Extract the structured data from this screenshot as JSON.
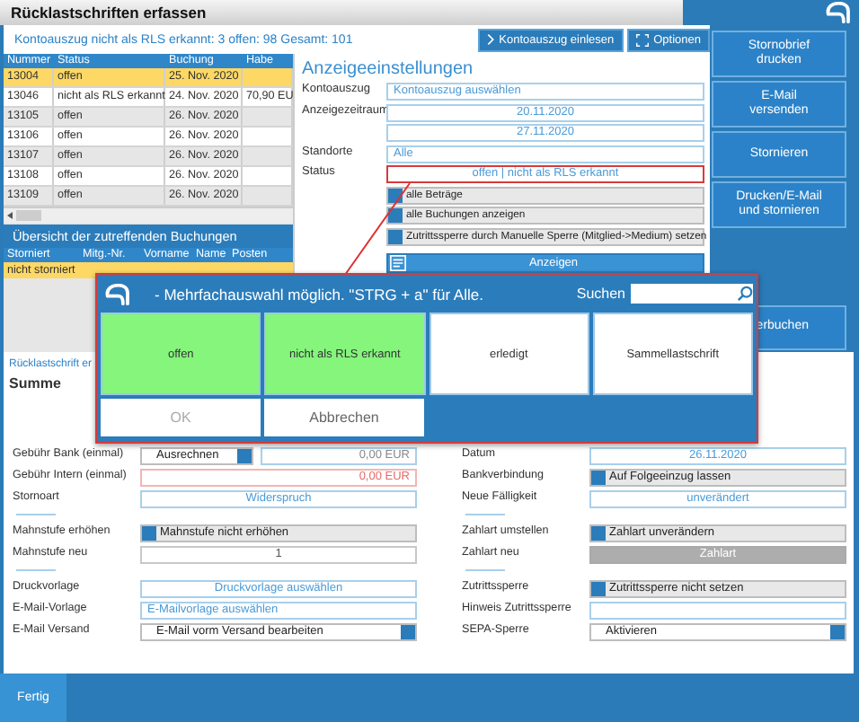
{
  "window": {
    "title": "Rücklastschriften erfassen"
  },
  "summary": "Kontoauszug  nicht als RLS erkannt: 3 offen: 98 Gesamt: 101",
  "toolbar": [
    "Kontoauszug einlesen",
    "Optionen"
  ],
  "bookings_table": {
    "columns": [
      "Nummer",
      "Status",
      "Buchung",
      "Habe"
    ],
    "rows": [
      {
        "cells": [
          "13004",
          "offen",
          "25. Nov. 2020"
        ],
        "selected": true
      },
      {
        "cells": [
          "13046",
          "nicht als RLS erkannt",
          "24. Nov. 2020",
          "70,90 EU"
        ],
        "selected": false
      },
      {
        "cells": [
          "13105",
          "offen",
          "26. Nov. 2020"
        ],
        "selected": false
      },
      {
        "cells": [
          "13106",
          "offen",
          "26. Nov. 2020"
        ],
        "selected": false
      },
      {
        "cells": [
          "13107",
          "offen",
          "26. Nov. 2020"
        ],
        "selected": false
      },
      {
        "cells": [
          "13108",
          "offen",
          "26. Nov. 2020"
        ],
        "selected": false
      },
      {
        "cells": [
          "13109",
          "offen",
          "26. Nov. 2020"
        ],
        "selected": false
      }
    ]
  },
  "overview": {
    "title": "Übersicht der zutreffenden Buchungen",
    "columns": [
      "Storniert",
      "Mitg.-Nr.",
      "Vorname",
      "Name",
      "Posten"
    ],
    "rows": [
      {
        "cells": [
          "nicht storniert"
        ],
        "selected": true
      }
    ]
  },
  "display_settings": {
    "title": "Anzeigeeinstellungen",
    "fields": [
      {
        "label": "Kontoauszug",
        "value": "Kontoauszug auswählen",
        "kind": "input"
      },
      {
        "label": "Anzeigezeitraum",
        "value": "20.11.2020",
        "kind": "date"
      },
      {
        "value": "27.11.2020",
        "kind": "date"
      },
      {
        "label": "Standorte",
        "value": "Alle",
        "kind": "input"
      },
      {
        "label": "Status",
        "value": "offen | nicht als RLS erkannt",
        "kind": "status"
      }
    ],
    "options": [
      "alle Beträge",
      "alle Buchungen anzeigen",
      "Zutrittssperre durch Manuelle Sperre (Mitglied->Medium) setzen"
    ],
    "show_button": "Anzeigen"
  },
  "actions": [
    "Stornobrief drucken",
    "E-Mail versenden",
    "Stornieren",
    "Drucken/E-Mail und stornieren"
  ],
  "partial_action": "erbuchen",
  "form": {
    "heading": "Rücklastschrift er",
    "subheading": "Summe",
    "left": [
      {
        "kind": "row",
        "label": "Gebühr Bank (einmal)",
        "fields": [
          {
            "kind": "option",
            "value": "Ausrechnen"
          },
          {
            "kind": "amount",
            "value": "0,00 EUR"
          }
        ]
      },
      {
        "kind": "row",
        "label": "Gebühr Intern (einmal)",
        "fields": [
          {
            "kind": "error",
            "value": "0,00 EUR"
          }
        ]
      },
      {
        "kind": "row",
        "label": "Stornoart",
        "fields": [
          {
            "kind": "select",
            "value": "Widerspruch"
          }
        ]
      },
      {
        "kind": "divider"
      },
      {
        "kind": "row",
        "label": "Mahnstufe erhöhen",
        "fields": [
          {
            "kind": "toggle",
            "value": "Mahnstufe nicht erhöhen"
          }
        ]
      },
      {
        "kind": "row",
        "label": "Mahnstufe neu",
        "fields": [
          {
            "kind": "number",
            "value": "1"
          }
        ]
      },
      {
        "kind": "divider"
      },
      {
        "kind": "row",
        "label": "Druckvorlage",
        "fields": [
          {
            "kind": "select",
            "value": "Druckvorlage auswählen"
          }
        ]
      },
      {
        "kind": "row",
        "label": "E-Mail-Vorlage",
        "fields": [
          {
            "kind": "input",
            "value": "E-Mailvorlage auswählen"
          }
        ]
      },
      {
        "kind": "row",
        "label": "E-Mail Versand",
        "fields": [
          {
            "kind": "option",
            "value": "E-Mail vorm Versand bearbeiten"
          }
        ]
      }
    ],
    "right": [
      {
        "kind": "row",
        "label": "Datum",
        "fields": [
          {
            "kind": "select",
            "value": "26.11.2020"
          }
        ]
      },
      {
        "kind": "row",
        "label": "Bankverbindung",
        "fields": [
          {
            "kind": "toggle",
            "value": "Auf Folgeeinzug lassen"
          }
        ]
      },
      {
        "kind": "row",
        "label": "Neue Fälligkeit",
        "fields": [
          {
            "kind": "select",
            "value": "unverändert"
          }
        ]
      },
      {
        "kind": "divider"
      },
      {
        "kind": "row",
        "label": "Zahlart umstellen",
        "fields": [
          {
            "kind": "toggle",
            "value": "Zahlart unverändern"
          }
        ]
      },
      {
        "kind": "row",
        "label": "Zahlart neu",
        "fields": [
          {
            "kind": "disabled",
            "value": "Zahlart"
          }
        ]
      },
      {
        "kind": "divider"
      },
      {
        "kind": "row",
        "label": "Zutrittssperre",
        "fields": [
          {
            "kind": "toggle",
            "value": "Zutrittssperre nicht setzen"
          }
        ]
      },
      {
        "kind": "row",
        "label": "Hinweis Zutrittssperre",
        "fields": [
          {
            "kind": "input"
          }
        ]
      },
      {
        "kind": "row",
        "label": "SEPA-Sperre",
        "fields": [
          {
            "kind": "option",
            "value": "Aktivieren"
          }
        ]
      }
    ]
  },
  "dialog": {
    "message": "- Mehrfachauswahl möglich. \"STRG + a\" für Alle.",
    "search_label": "Suchen",
    "options": [
      {
        "label": "offen",
        "selected": true
      },
      {
        "label": "nicht als RLS erkannt",
        "selected": true
      },
      {
        "label": "erledigt",
        "selected": false
      },
      {
        "label": "Sammellastschrift",
        "selected": false
      }
    ],
    "buttons": [
      {
        "label": "OK",
        "disabled": true
      },
      {
        "label": "Abbrechen",
        "disabled": false
      }
    ]
  },
  "footer": {
    "button": "Fertig"
  }
}
